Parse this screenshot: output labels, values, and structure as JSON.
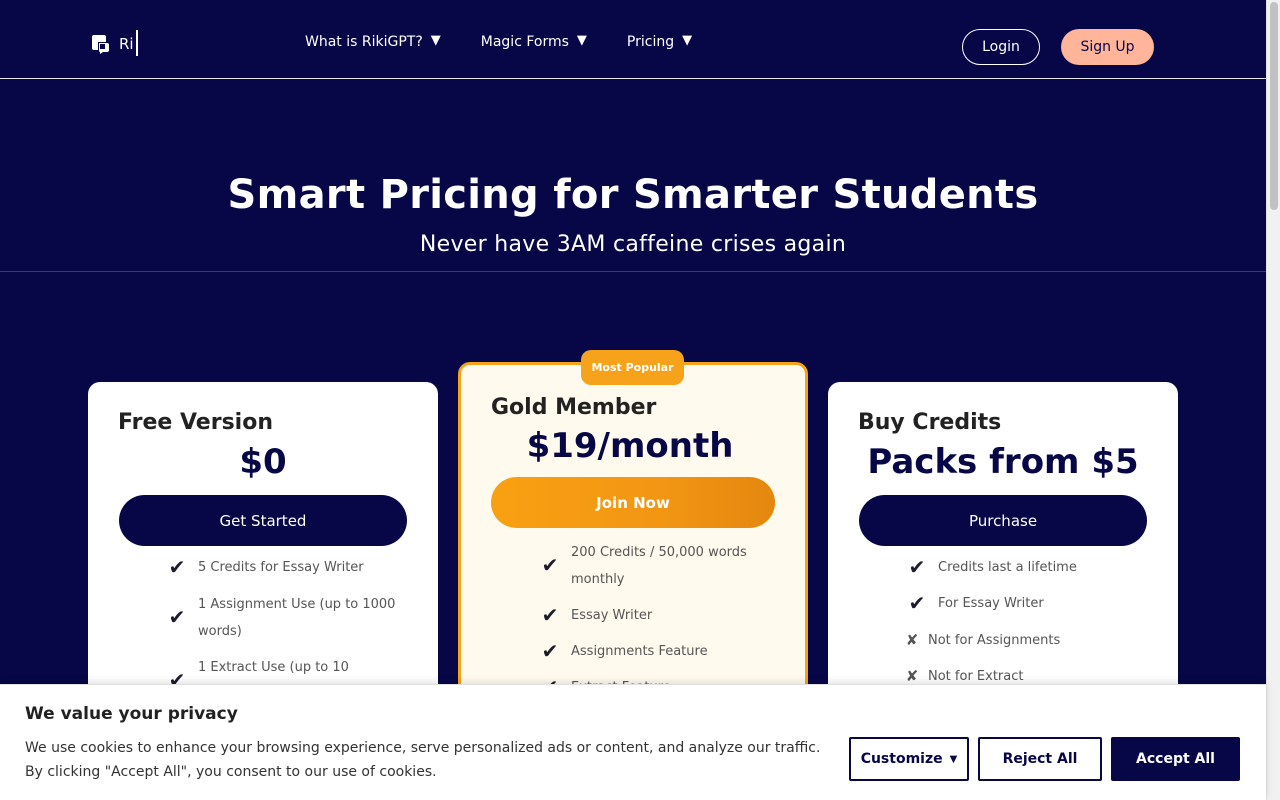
{
  "header": {
    "logo_text": "Ri",
    "nav": [
      {
        "label": "What is RikiGPT?",
        "arrow": "▼"
      },
      {
        "label": "Magic Forms",
        "arrow": "▼"
      },
      {
        "label": "Pricing",
        "arrow": "▼"
      }
    ],
    "login_label": "Login",
    "signup_label": "Sign Up"
  },
  "hero": {
    "title": "Smart Pricing for Smarter Students",
    "subtitle": "Never have 3AM caffeine crises again"
  },
  "plans": {
    "free": {
      "name": "Free Version",
      "price": "$0",
      "button": "Get Started",
      "features": [
        {
          "text": "5 Credits for Essay Writer",
          "included": true
        },
        {
          "text": "1 Assignment Use (up to 1000 words)",
          "included": true
        },
        {
          "text": "1 Extract Use (up to 10",
          "included": true
        }
      ]
    },
    "gold": {
      "badge": "Most Popular",
      "name": "Gold Member",
      "price": "$19/month",
      "button": "Join Now",
      "features": [
        {
          "text": "200 Credits / 50,000 words monthly",
          "included": true
        },
        {
          "text": "Essay Writer",
          "included": true
        },
        {
          "text": "Assignments Feature",
          "included": true
        },
        {
          "text": "Extract Feature",
          "included": true
        }
      ]
    },
    "credits": {
      "name": "Buy Credits",
      "price": "Packs from $5",
      "button": "Purchase",
      "features": [
        {
          "text": "Credits last a lifetime",
          "included": true
        },
        {
          "text": "For Essay Writer",
          "included": true
        },
        {
          "text": "Not for Assignments",
          "included": false
        },
        {
          "text": "Not for Extract",
          "included": false
        }
      ]
    }
  },
  "icons": {
    "check": "✔",
    "cross": "✘"
  },
  "cookie": {
    "title": "We value your privacy",
    "text": "We use cookies to enhance your browsing experience, serve personalized ads or content, and analyze our traffic. By clicking \"Accept All\", you consent to our use of cookies.",
    "customize_label": "Customize",
    "reject_label": "Reject All",
    "accept_label": "Accept All"
  },
  "colors": {
    "background": "#070747",
    "accent_orange": "#f7a21b",
    "signup_peach": "#ffb59a"
  }
}
